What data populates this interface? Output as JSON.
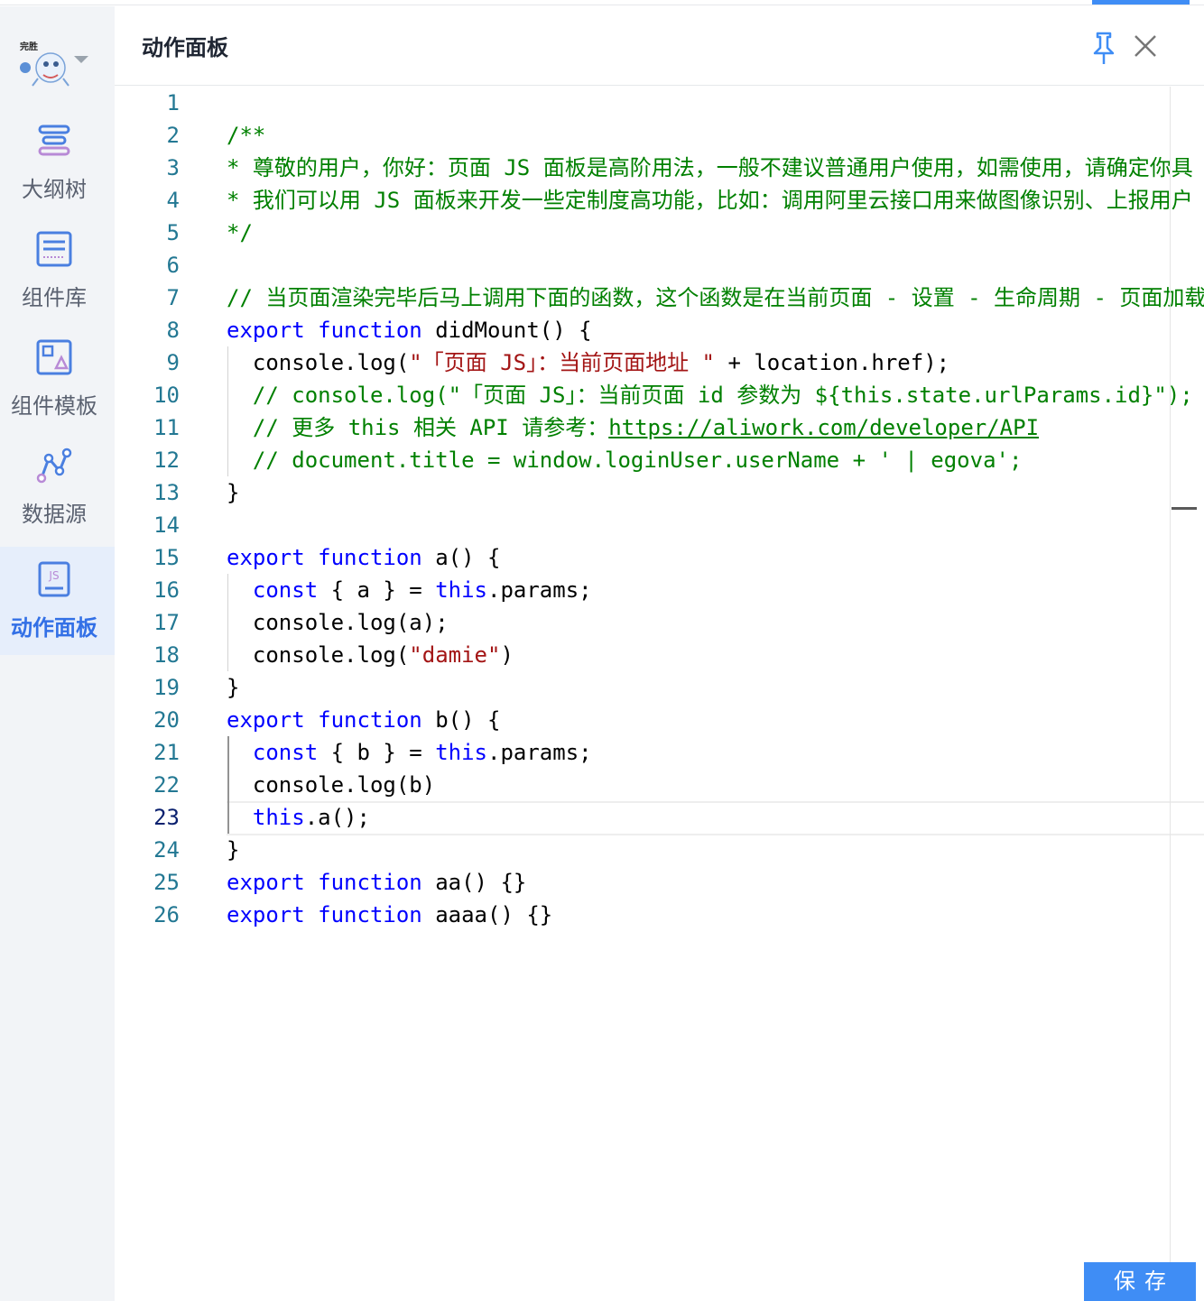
{
  "app": {
    "logo_text": "完胜"
  },
  "sidebar": {
    "items": [
      {
        "label": "大纲树",
        "icon": "outline-tree-icon",
        "active": false
      },
      {
        "label": "组件库",
        "icon": "component-library-icon",
        "active": false
      },
      {
        "label": "组件模板",
        "icon": "component-template-icon",
        "active": false
      },
      {
        "label": "数据源",
        "icon": "data-source-icon",
        "active": false
      },
      {
        "label": "动作面板",
        "icon": "js-panel-icon",
        "active": true
      }
    ]
  },
  "header": {
    "title": "动作面板",
    "pin_icon": "pin-icon",
    "close_icon": "close-icon"
  },
  "editor": {
    "current_line": 23,
    "lines": [
      {
        "n": "1",
        "tokens": []
      },
      {
        "n": "2",
        "tokens": [
          {
            "t": "/**",
            "c": "cm"
          }
        ]
      },
      {
        "n": "3",
        "tokens": [
          {
            "t": "* 尊敬的用户，你好：页面 JS 面板是高阶用法，一般不建议普通用户使用，如需使用，请确定你具",
            "c": "cm"
          }
        ]
      },
      {
        "n": "4",
        "tokens": [
          {
            "t": "* 我们可以用 JS 面板来开发一些定制度高功能，比如：调用阿里云接口用来做图像识别、上报用户",
            "c": "cm"
          }
        ]
      },
      {
        "n": "5",
        "tokens": [
          {
            "t": "*/",
            "c": "cm"
          }
        ]
      },
      {
        "n": "6",
        "tokens": []
      },
      {
        "n": "7",
        "tokens": [
          {
            "t": "// 当页面渲染完毕后马上调用下面的函数，这个函数是在当前页面 - 设置 - 生命周期 - 页面加载",
            "c": "cm"
          }
        ]
      },
      {
        "n": "8",
        "tokens": [
          {
            "t": "export",
            "c": "kw"
          },
          {
            "t": " "
          },
          {
            "t": "function",
            "c": "kw"
          },
          {
            "t": " didMount() {"
          }
        ]
      },
      {
        "n": "9",
        "tokens": [
          {
            "t": "  console.log("
          },
          {
            "t": "\"「页面 JS」：当前页面地址 \"",
            "c": "st"
          },
          {
            "t": " + location.href);"
          }
        ]
      },
      {
        "n": "10",
        "tokens": [
          {
            "t": "  "
          },
          {
            "t": "// console.log(\"「页面 JS」：当前页面 id 参数为 ${this.state.urlParams.id}\");",
            "c": "cm"
          }
        ]
      },
      {
        "n": "11",
        "tokens": [
          {
            "t": "  "
          },
          {
            "t": "// 更多 this 相关 API 请参考：",
            "c": "cm"
          },
          {
            "t": "https://aliwork.com/developer/API",
            "c": "cm url"
          }
        ]
      },
      {
        "n": "12",
        "tokens": [
          {
            "t": "  "
          },
          {
            "t": "// document.title = window.loginUser.userName + ' | egova';",
            "c": "cm"
          }
        ]
      },
      {
        "n": "13",
        "tokens": [
          {
            "t": "}"
          }
        ]
      },
      {
        "n": "14",
        "tokens": []
      },
      {
        "n": "15",
        "tokens": [
          {
            "t": "export",
            "c": "kw"
          },
          {
            "t": " "
          },
          {
            "t": "function",
            "c": "kw"
          },
          {
            "t": " a() {"
          }
        ]
      },
      {
        "n": "16",
        "tokens": [
          {
            "t": "  "
          },
          {
            "t": "const",
            "c": "kw"
          },
          {
            "t": " { a } = "
          },
          {
            "t": "this",
            "c": "kw"
          },
          {
            "t": ".params;"
          }
        ]
      },
      {
        "n": "17",
        "tokens": [
          {
            "t": "  console.log(a);"
          }
        ]
      },
      {
        "n": "18",
        "tokens": [
          {
            "t": "  console.log("
          },
          {
            "t": "\"damie\"",
            "c": "st"
          },
          {
            "t": ")"
          }
        ]
      },
      {
        "n": "19",
        "tokens": [
          {
            "t": "}"
          }
        ]
      },
      {
        "n": "20",
        "tokens": [
          {
            "t": "export",
            "c": "kw"
          },
          {
            "t": " "
          },
          {
            "t": "function",
            "c": "kw"
          },
          {
            "t": " b() {"
          }
        ]
      },
      {
        "n": "21",
        "tokens": [
          {
            "t": "  "
          },
          {
            "t": "const",
            "c": "kw"
          },
          {
            "t": " { b } = "
          },
          {
            "t": "this",
            "c": "kw"
          },
          {
            "t": ".params;"
          }
        ]
      },
      {
        "n": "22",
        "tokens": [
          {
            "t": "  console.log(b)"
          }
        ]
      },
      {
        "n": "23",
        "tokens": [
          {
            "t": "  "
          },
          {
            "t": "this",
            "c": "kw"
          },
          {
            "t": ".a();"
          }
        ]
      },
      {
        "n": "24",
        "tokens": [
          {
            "t": "}"
          }
        ]
      },
      {
        "n": "25",
        "tokens": [
          {
            "t": "export",
            "c": "kw"
          },
          {
            "t": " "
          },
          {
            "t": "function",
            "c": "kw"
          },
          {
            "t": " aa() {}"
          }
        ]
      },
      {
        "n": "26",
        "tokens": [
          {
            "t": "export",
            "c": "kw"
          },
          {
            "t": " "
          },
          {
            "t": "function",
            "c": "kw"
          },
          {
            "t": " aaaa() {}"
          }
        ]
      }
    ]
  },
  "footer": {
    "save_label": "保存"
  },
  "colors": {
    "accent": "#3f8df5",
    "keyword": "#0000ff",
    "comment": "#008000",
    "string": "#a31515",
    "line_number": "#237893"
  }
}
